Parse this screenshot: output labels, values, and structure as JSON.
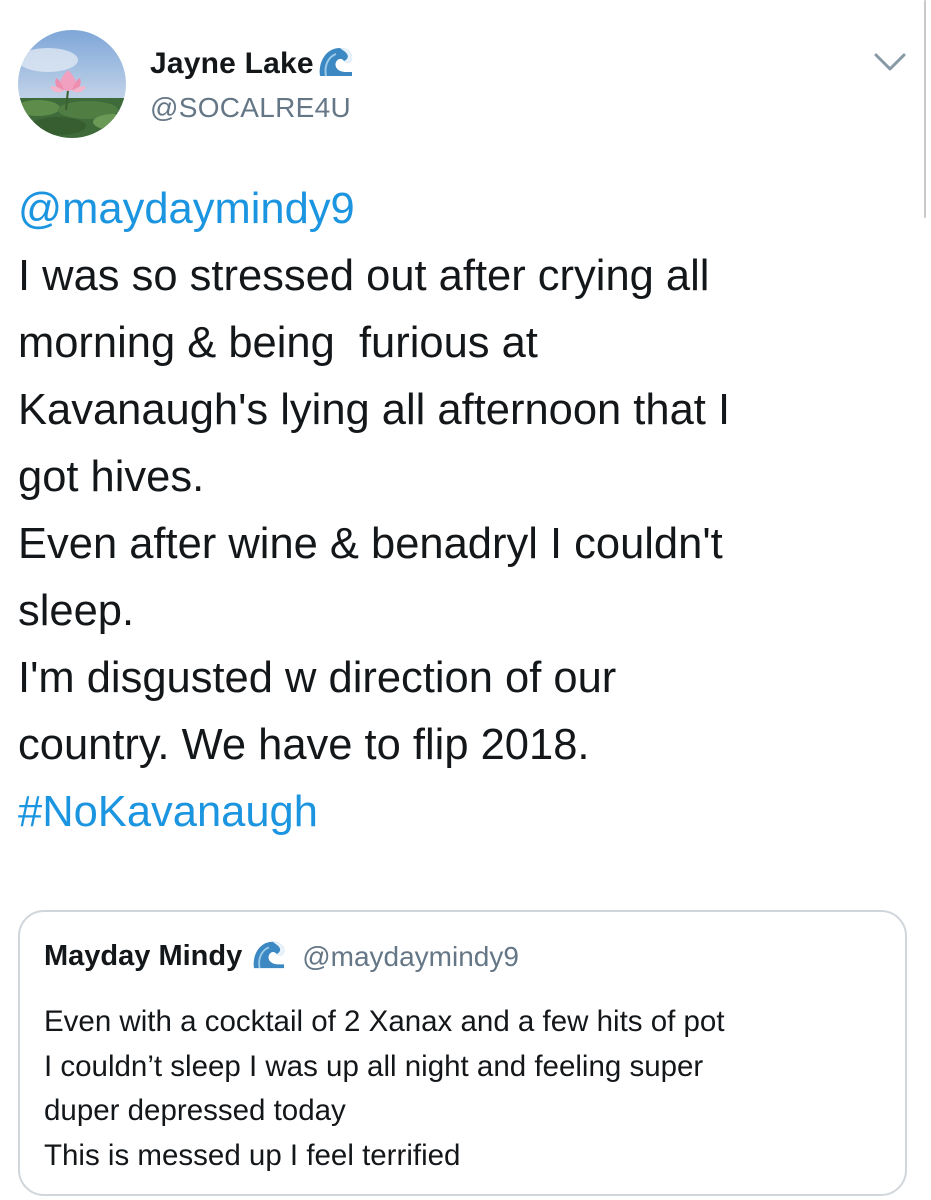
{
  "tweet": {
    "author": {
      "display_name": "Jayne Lake",
      "handle": "@SOCALRE4U",
      "avatar_icon": "lotus-photo-avatar",
      "badge_icon": "blue-wave-emoji"
    },
    "menu_icon": "chevron-down-icon",
    "mention": "@maydaymindy9",
    "body_lines": [
      "I was so stressed out after crying all",
      "morning & being  furious at",
      "Kavanaugh's lying all afternoon that I",
      "got hives.",
      "Even after wine & benadryl I couldn't",
      "sleep.",
      "I'm disgusted w direction of our",
      "country. We have to flip 2018."
    ],
    "hashtag": "#NoKavanaugh"
  },
  "quoted_tweet": {
    "display_name": "Mayday Mindy",
    "handle": "@maydaymindy9",
    "badge_icon": "blue-wave-emoji",
    "body_lines": [
      "Even with a cocktail of 2 Xanax and a few hits of pot",
      "I couldn’t sleep I was up all night and feeling super",
      "duper depressed today",
      "This is messed up I feel terrified"
    ]
  },
  "colors": {
    "link": "#1b95e0",
    "text": "#14171a",
    "secondary": "#657786",
    "border": "#d0d6db"
  }
}
